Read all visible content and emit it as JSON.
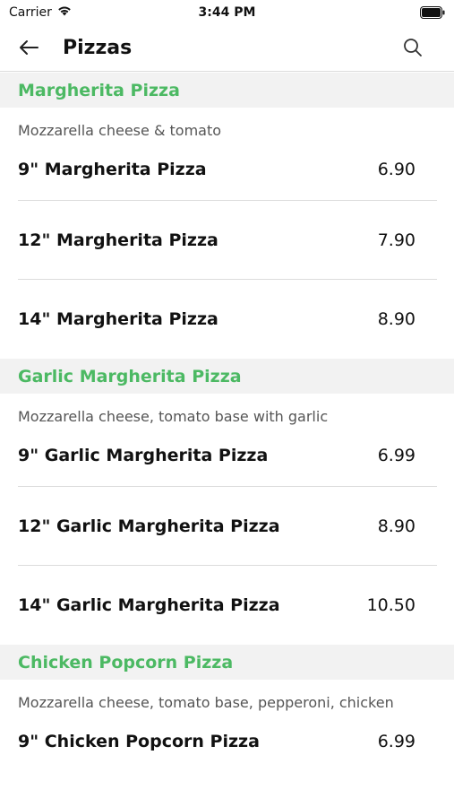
{
  "status_bar": {
    "carrier": "Carrier",
    "time": "3:44 PM"
  },
  "nav": {
    "title": "Pizzas",
    "back_icon": "arrow-left-icon",
    "search_icon": "search-icon"
  },
  "colors": {
    "section_title": "#4cb963",
    "section_bg": "#f2f2f2",
    "divider": "#dcdcdc"
  },
  "sections": [
    {
      "title": "Margherita Pizza",
      "description": "Mozzarella cheese & tomato",
      "items": [
        {
          "name": "9\" Margherita Pizza",
          "price": "6.90"
        },
        {
          "name": "12\" Margherita Pizza",
          "price": "7.90"
        },
        {
          "name": "14\" Margherita Pizza",
          "price": "8.90"
        }
      ]
    },
    {
      "title": "Garlic Margherita Pizza",
      "description": "Mozzarella cheese, tomato base with garlic",
      "items": [
        {
          "name": "9\" Garlic Margherita Pizza",
          "price": "6.99"
        },
        {
          "name": "12\" Garlic Margherita Pizza",
          "price": "8.90"
        },
        {
          "name": "14\" Garlic Margherita Pizza",
          "price": "10.50"
        }
      ]
    },
    {
      "title": "Chicken Popcorn Pizza",
      "description": "Mozzarella cheese, tomato base, pepperoni, chicken",
      "items": [
        {
          "name": "9\" Chicken Popcorn Pizza",
          "price": "6.99"
        }
      ]
    }
  ]
}
